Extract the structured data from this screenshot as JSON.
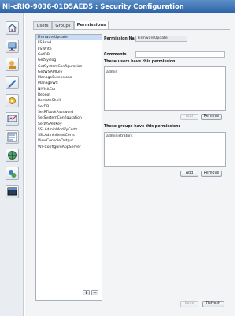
{
  "window": {
    "title": "NI-cRIO-9036-01D5AED5 : Security Configuration"
  },
  "sidebar": {
    "items": [
      {
        "icon": "home-icon"
      },
      {
        "icon": "network-config-icon"
      },
      {
        "icon": "users-key-icon"
      },
      {
        "icon": "pen-icon"
      },
      {
        "icon": "system-settings-icon"
      },
      {
        "icon": "chart-monitor-icon"
      },
      {
        "icon": "diagram-icon"
      },
      {
        "icon": "network-globe-icon"
      },
      {
        "icon": "user-globe-icon"
      },
      {
        "icon": "console-window-icon"
      }
    ]
  },
  "tabs": [
    {
      "label": "Users"
    },
    {
      "label": "Groups"
    },
    {
      "label": "Permissions",
      "active": true
    }
  ],
  "permissions": {
    "items": [
      "FirmwareUpdate",
      "FSRead",
      "FSWrite",
      "GetDB",
      "GetSyslog",
      "GetSystemConfiguration",
      "GetWSAPIKey",
      "ManageExtensions",
      "ManageWS",
      "NIVIsitCor",
      "Reboot",
      "RemoteShell",
      "SetDB",
      "SetRTLockPassword",
      "SetSystemConfiguration",
      "SetWSAPIKey",
      "SSLAdminModifyCerts",
      "SSLAdminReadCerts",
      "ViewConsoleOutput",
      "WIFConfigureAppServer"
    ],
    "selected_index": 0,
    "add_label": "+",
    "remove_label": "−"
  },
  "detail": {
    "name_label": "Permission Name",
    "name_value": "FirmwareUpdate",
    "comments_label": "Comments",
    "comments_value": "",
    "users_label": "These users have this permission:",
    "users": [
      "admin"
    ],
    "users_add": "Add",
    "users_remove": "Remove",
    "groups_label": "These groups have this permission:",
    "groups": [
      "administrators"
    ],
    "groups_add": "Add",
    "groups_remove": "Remove"
  },
  "footer": {
    "save_label": "Save",
    "refresh_label": "Refresh"
  }
}
